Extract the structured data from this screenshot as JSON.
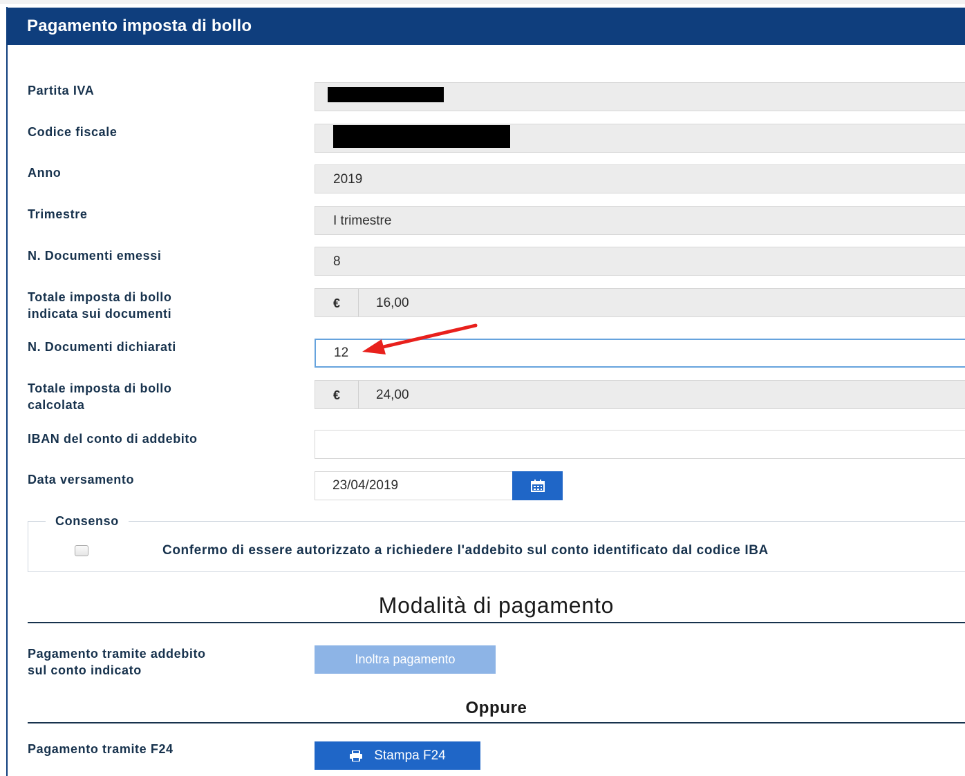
{
  "header": {
    "title": "Pagamento imposta di bollo"
  },
  "fields": {
    "partita_iva": {
      "label": "Partita IVA",
      "value": ""
    },
    "codice_fiscale": {
      "label": "Codice fiscale",
      "value": ""
    },
    "anno": {
      "label": "Anno",
      "value": "2019"
    },
    "trimestre": {
      "label": "Trimestre",
      "value": "I trimestre"
    },
    "documenti_emessi": {
      "label": "N. Documenti emessi",
      "value": "8"
    },
    "totale_indicata": {
      "label_line1": "Totale imposta di bollo",
      "label_line2": "indicata sui documenti",
      "currency": "€",
      "value": "16,00"
    },
    "documenti_dichiarati": {
      "label": "N. Documenti dichiarati",
      "value": "12"
    },
    "totale_calcolata": {
      "label_line1": "Totale imposta di bollo",
      "label_line2": "calcolata",
      "currency": "€",
      "value": "24,00"
    },
    "iban": {
      "label": "IBAN del conto di addebito",
      "value": ""
    },
    "data_versamento": {
      "label": "Data versamento",
      "value": "23/04/2019"
    }
  },
  "consenso": {
    "legend": "Consenso",
    "checked": false,
    "text": "Confermo di essere autorizzato a richiedere l'addebito sul conto identificato dal codice IBA"
  },
  "modalita": {
    "title": "Modalità di pagamento",
    "addebito_label_line1": "Pagamento tramite addebito",
    "addebito_label_line2": "sul conto indicato",
    "inoltra_button": "Inoltra pagamento",
    "oppure": "Oppure",
    "f24_label": "Pagamento tramite F24",
    "stampa_button": "Stampa F24"
  },
  "icons": {
    "calendar": "calendar-icon",
    "print": "print-icon"
  },
  "colors": {
    "header_bg": "#0f3e7d",
    "primary": "#1f66c7",
    "disabled": "#8db4e6",
    "annotation_arrow": "#e8201c"
  }
}
